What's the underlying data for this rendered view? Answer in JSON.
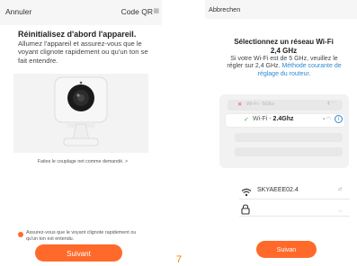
{
  "left_screen": {
    "header": {
      "cancel": "Annuler",
      "qr_code": "Code QR",
      "qr_icon": "qr-icon"
    },
    "title": "Réinitialisez d'abord l'appareil.",
    "description": "Allumez l'appareil et assurez-vous que le voyant clignote rapidement ou qu'un ton se fait entendre.",
    "help_link": "Faites le couplage net comme demandé. >",
    "confirm_checkbox": {
      "checked": true,
      "label": "Assurez-vous que le voyant clignote rapidement ou qu'un ton est entendu."
    },
    "next_button": "Suivant",
    "accent_color": "#ff6a2b"
  },
  "page_number": "7",
  "right_screen": {
    "header": {
      "back": "Abbrechen"
    },
    "title_line1": "Sélectionnez un réseau Wi-Fi",
    "title_line2": "2,4 GHz",
    "description": "Si votre Wi-Fi est de 5 GHz, veuillez le régler sur 2,4 GHz.",
    "description_link": "Méthode courante de réglage du routeur.",
    "illustration": {
      "bad_network": {
        "mark": "✕",
        "label": "Wi-Fi - 5Ghz"
      },
      "good_network": {
        "mark": "✓",
        "label_prefix": "Wi-Fi - ",
        "label_bold": "2.4Ghz"
      },
      "info_symbol": "i"
    },
    "wifi_name": "SKYAEEE02.4",
    "password_value": "",
    "next_button": "Suivan",
    "accent_color": "#ff6a2b",
    "link_color": "#2d8ad3"
  }
}
